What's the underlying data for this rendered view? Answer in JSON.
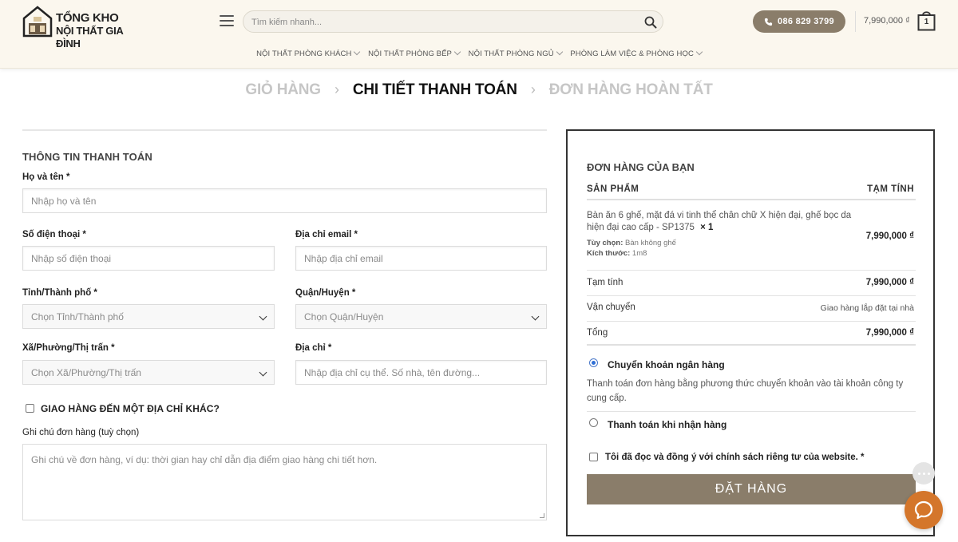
{
  "header": {
    "logo_line1": "TỔNG KHO",
    "logo_line2": "NỘI THẤT GIA ĐÌNH",
    "search_placeholder": "Tìm kiếm nhanh...",
    "phone": "086 829 3799",
    "cart_total": "7,990,000 ₫",
    "cart_count": "1",
    "accent_color": "#8a7d6a",
    "nav": [
      "NỘI THẤT PHÒNG KHÁCH",
      "NỘI THẤT PHÒNG BẾP",
      "NỘI THẤT PHÒNG NGỦ",
      "PHÒNG LÀM VIỆC & PHÒNG HỌC"
    ]
  },
  "breadcrumb": {
    "steps": [
      "GIỎ HÀNG",
      "CHI TIẾT THANH TOÁN",
      "ĐƠN HÀNG HOÀN TẤT"
    ],
    "current_index": 1
  },
  "billing": {
    "title": "THÔNG TIN THANH TOÁN",
    "name_label": "Họ và tên *",
    "name_placeholder": "Nhập họ và tên",
    "phone_label": "Số điện thoại *",
    "phone_placeholder": "Nhập số điện thoại",
    "email_label": "Địa chỉ email *",
    "email_placeholder": "Nhập địa chỉ email",
    "province_label": "Tỉnh/Thành phố *",
    "province_value": "Chọn Tỉnh/Thành phố",
    "district_label": "Quận/Huyện *",
    "district_value": "Chọn Quận/Huyện",
    "ward_label": "Xã/Phường/Thị trấn *",
    "ward_value": "Chọn Xã/Phường/Thị trấn",
    "address_label": "Địa chỉ *",
    "address_placeholder": "Nhập địa chỉ cụ thể. Số nhà, tên đường...",
    "ship_different": "GIAO HÀNG ĐẾN MỘT ĐỊA CHỈ KHÁC?",
    "ship_different_checked": false,
    "notes_label": "Ghi chú đơn hàng (tuỳ chọn)",
    "notes_placeholder": "Ghi chú về đơn hàng, ví dụ: thời gian hay chỉ dẫn địa điểm giao hàng chi tiết hơn."
  },
  "order": {
    "title": "ĐƠN HÀNG CỦA BẠN",
    "col_product": "SẢN PHẨM",
    "col_subtotal": "TẠM TÍNH",
    "product_name": "Bàn ăn 6 ghế, mặt đá vi tinh thể chân chữ X hiện đại, ghế bọc da hiện đại cao cấp - SP1375",
    "product_qty": "× 1",
    "product_price": "7,990,000 ₫",
    "option_label": "Tùy chọn:",
    "option_value": "Bàn không ghế",
    "size_label": "Kích thước:",
    "size_value": "1m8",
    "subtotal_label": "Tạm tính",
    "subtotal_value": "7,990,000 ₫",
    "shipping_label": "Vận chuyển",
    "shipping_value": "Giao hàng lắp đặt tại nhà",
    "total_label": "Tổng",
    "total_value": "7,990,000 ₫",
    "payment_bank": "Chuyển khoản ngân hàng",
    "payment_bank_desc": "Thanh toán đơn hàng bằng phương thức chuyển khoản vào tài khoản công ty cung cấp.",
    "payment_cod": "Thanh toán khi nhận hàng",
    "selected_payment": "bank",
    "terms": "Tôi đã đọc và đồng ý với chính sách riêng tư của website. *",
    "place_order": "ĐẶT HÀNG"
  }
}
